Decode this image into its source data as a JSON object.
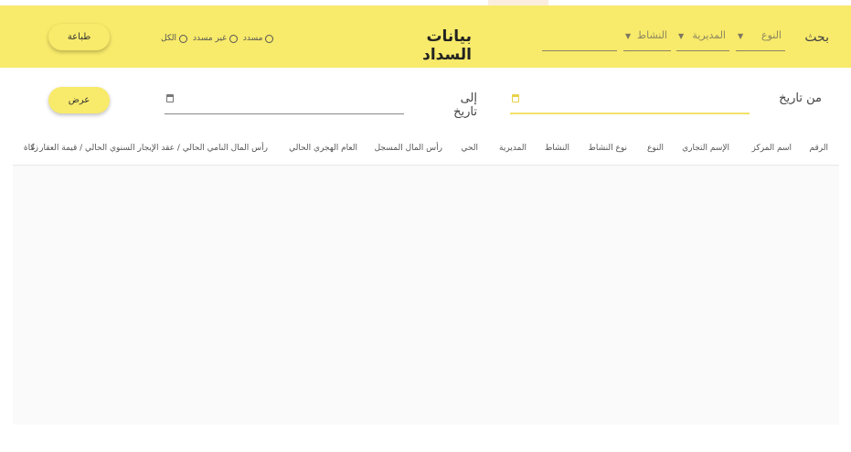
{
  "header": {
    "search_label": "بحث",
    "filters": [
      {
        "label": "النوع"
      },
      {
        "label": "المديرية"
      },
      {
        "label": "النشاط"
      },
      {
        "label": ""
      }
    ],
    "title": "بيانات السداد",
    "radio_options": [
      "مسدد",
      "غير مسدد",
      "الكل"
    ],
    "print_label": "طباعة",
    "background_color": "#f8ea6a"
  },
  "date_filter": {
    "from_label": "من تاريخ",
    "to_label": "إلى تاريخ",
    "show_label": "عرض"
  },
  "table": {
    "columns": [
      "الرقم",
      "اسم المركز",
      "الإسم التجاري",
      "النوع",
      "نوع النشاط",
      "النشاط",
      "المديرية",
      "الحي",
      "رأس المال المسجل",
      "العام الهجري الحالي",
      "رأس المال النامي الحالي / عقد الإيجار السنوي الحالي / قيمة العقار",
      "زكاة"
    ],
    "rows": []
  }
}
